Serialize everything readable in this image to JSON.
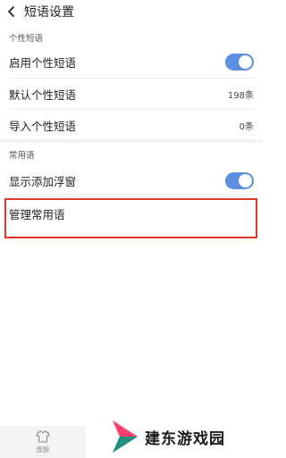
{
  "header": {
    "title": "短语设置"
  },
  "sections": {
    "personal": {
      "label": "个性短语",
      "enable_label": "启用个性短语",
      "enable_on": true,
      "default_label": "默认个性短语",
      "default_value": "198条",
      "import_label": "导入个性短语",
      "import_value": "0条"
    },
    "common": {
      "label": "常用语",
      "float_label": "显示添加浮窗",
      "float_on": true,
      "manage_label": "管理常用语"
    }
  },
  "bottom": {
    "skin_label": "皮肤"
  },
  "watermark": {
    "text": "建东游戏园"
  },
  "colors": {
    "toggle_on": "#5b8fe0",
    "highlight": "#e0362a"
  }
}
